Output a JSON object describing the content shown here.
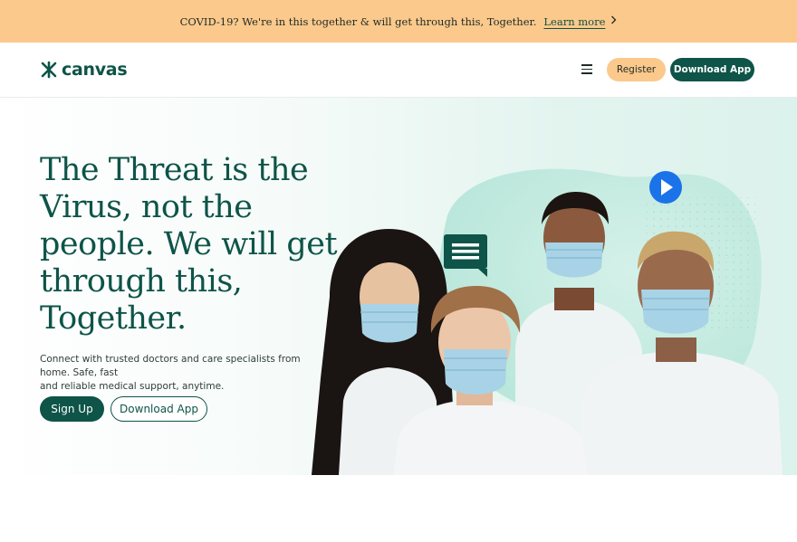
{
  "announcement": {
    "message": "COVID-19? We're in this together & will get through this, Together.",
    "link_label": "Learn more",
    "chevron_icon": "chevron-right-icon"
  },
  "header": {
    "logo_text": "canvas",
    "menu_icon": "hamburger-menu-icon",
    "register_label": "Register",
    "download_label": "Download App"
  },
  "hero": {
    "headline_lines": [
      "The Threat is the",
      "Virus, not the",
      "people. We will get",
      "through this,",
      "Together."
    ],
    "subtext_lines": [
      "Connect with trusted doctors and care specialists from home. Safe, fast",
      "and reliable medical support, anytime."
    ],
    "signup_label": "Sign Up",
    "download_label": "Download App",
    "image_description_icons": [
      "play-icon",
      "chat-bubble-icon"
    ]
  },
  "colors": {
    "brand_green": "#0e5448",
    "accent_peach": "#fbc98c",
    "play_blue": "#1a73e8",
    "mint_blob": "#bfe9df"
  }
}
